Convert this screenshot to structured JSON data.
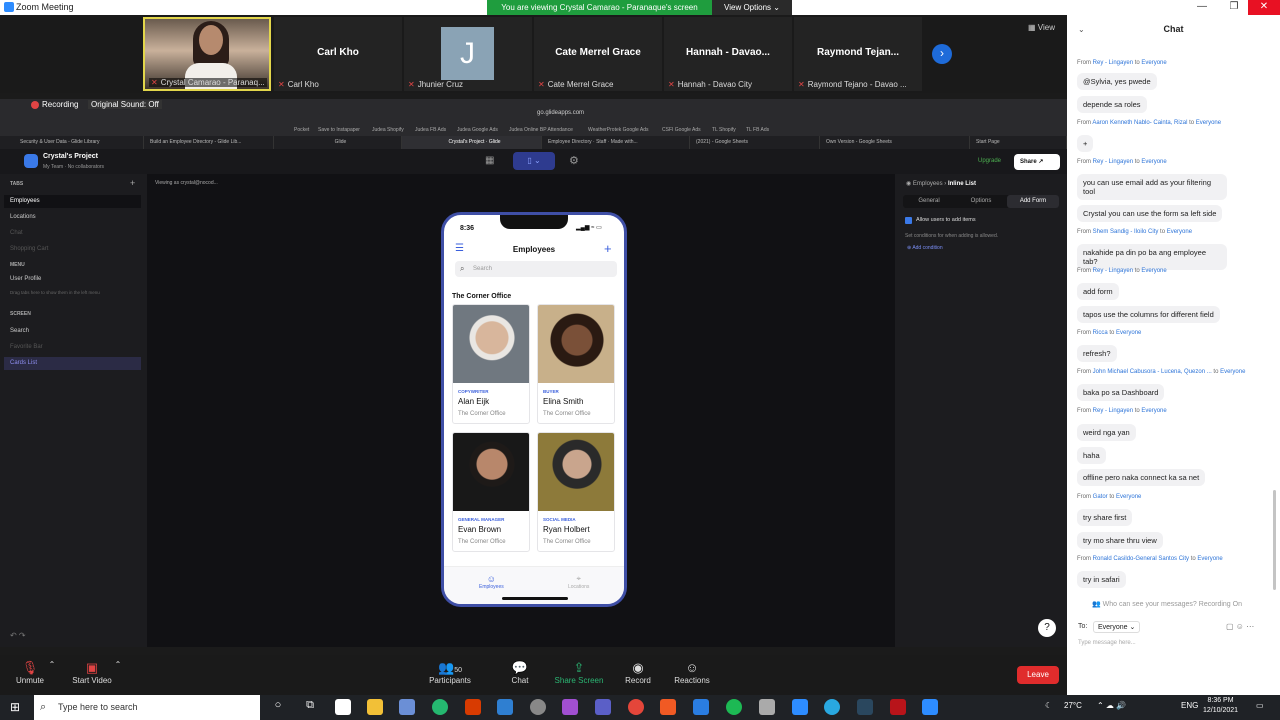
{
  "window": {
    "title": "Zoom Meeting",
    "banner": "You are viewing Crystal Camarao - Paranaque's screen",
    "view_options": "View Options ⌄",
    "minimize": "—",
    "restore": "❐",
    "close": "✕",
    "view_label": "View"
  },
  "participants": [
    {
      "name": "",
      "sub": "Crystal Camarao - Paranaq..."
    },
    {
      "name": "Carl Kho",
      "sub": "Carl Kho"
    },
    {
      "name": "",
      "avatar_letter": "J",
      "sub": "Jhunier Cruz"
    },
    {
      "name": "Cate Merrel Grace",
      "sub": "Cate Merrel Grace"
    },
    {
      "name": "Hannah - Davao...",
      "sub": "Hannah - Davao City"
    },
    {
      "name": "Raymond Tejan...",
      "sub": "Raymond Tejano - Davao ..."
    }
  ],
  "share": {
    "recording": "Recording",
    "original_sound": "Original Sound: Off",
    "url": "go.glideapps.com",
    "bookmarks": [
      "Pocket",
      "Save to Instapaper",
      "Judea Shopify",
      "Judea FB Ads",
      "Judea Google Ads",
      "Judea Online BP Attendance",
      "WeatherProtek Google Ads",
      "CSFI Google Ads",
      "TL Shopify",
      "TL FB Ads"
    ],
    "tabs": [
      {
        "label": "Security & User Data - Glide Library",
        "active": false
      },
      {
        "label": "Build an Employee Directory - Glide Lib...",
        "active": false
      },
      {
        "label": "Glide",
        "active": false
      },
      {
        "label": "Crystal's Project · Glide",
        "active": true
      },
      {
        "label": "Employee Directory · Staff · Made with...",
        "active": false
      },
      {
        "label": "(2021) - Google Sheets",
        "active": false
      },
      {
        "label": "Own Version - Google Sheets",
        "active": false
      },
      {
        "label": "Start Page",
        "active": false
      }
    ]
  },
  "glide": {
    "project_name": "Crystal's Project",
    "project_sub": "My Team · No collaborators",
    "upgrade": "Upgrade",
    "share": "Share",
    "viewing_as": "Viewing as crystal@nocod...",
    "sidebar": {
      "tabs_header": "TABS",
      "tabs": [
        "Employees",
        "Locations",
        "Chat",
        "Shopping Cart"
      ],
      "menu_header": "MENU",
      "menu": [
        "User Profile"
      ],
      "menu_hint": "Drag tabs here to show them in the left menu",
      "screen_header": "SCREEN",
      "screen": [
        "Search",
        "Favorite Bar",
        "Cards List"
      ]
    },
    "config": {
      "breadcrumb_parent": "Employees",
      "breadcrumb_current": "Inline List",
      "tabs": [
        "General",
        "Options",
        "Add Form"
      ],
      "allow_label": "Allow users to add items",
      "conditions_hint": "Set conditions for when adding is allowed.",
      "add_condition": "Add condition"
    }
  },
  "phone": {
    "time": "8:36",
    "status": "▂▄▆ ≈ ▭",
    "header": "Employees",
    "search_placeholder": "Search",
    "group": "The Corner Office",
    "cards": [
      {
        "role": "COPYWRITER",
        "name": "Alan Eijk",
        "office": "The Corner Office"
      },
      {
        "role": "BUYER",
        "name": "Elina Smith",
        "office": "The Corner Office"
      },
      {
        "role": "GENERAL MANAGER",
        "name": "Evan Brown",
        "office": "The Corner Office"
      },
      {
        "role": "SOCIAL MEDIA",
        "name": "Ryan Holbert",
        "office": "The Corner Office"
      }
    ],
    "tab_employees": "Employees",
    "tab_locations": "Locations"
  },
  "toolbar": {
    "unmute": "Unmute",
    "start_video": "Start Video",
    "participants": "Participants",
    "participants_count": "50",
    "chat": "Chat",
    "share_screen": "Share Screen",
    "record": "Record",
    "reactions": "Reactions",
    "leave": "Leave"
  },
  "chat": {
    "title": "Chat",
    "messages": [
      {
        "from": "Rey - Lingayen",
        "to": "Everyone",
        "text": "@Sylvia, yes pwede"
      },
      {
        "from": "",
        "to": "",
        "text": "depende sa roles"
      },
      {
        "from": "Aaron Kenneth Nablo- Cainta, Rizal",
        "to": "Everyone",
        "text": "+"
      },
      {
        "from": "Rey - Lingayen",
        "to": "Everyone",
        "text": "you can use email add as your filtering tool"
      },
      {
        "from": "",
        "to": "",
        "text": "Crystal you can use the form sa left side"
      },
      {
        "from": "Shem Sandig - Iloilo City",
        "to": "Everyone",
        "text": "nakahide pa din po ba ang employee tab?"
      },
      {
        "from": "Rey - Lingayen",
        "to": "Everyone",
        "text": "add form"
      },
      {
        "from": "",
        "to": "",
        "text": "tapos use the columns for different field"
      },
      {
        "from": "Ricca",
        "to": "Everyone",
        "text": "refresh?"
      },
      {
        "from": "John Michael Cabusora - Lucena, Quezon ...",
        "to": "Everyone",
        "text": "baka po sa Dashboard"
      },
      {
        "from": "Rey - Lingayen",
        "to": "Everyone",
        "text": "weird nga yan"
      },
      {
        "from": "",
        "to": "",
        "text": "haha"
      },
      {
        "from": "",
        "to": "",
        "text": "offline pero naka connect ka sa net"
      },
      {
        "from": "Gator",
        "to": "Everyone",
        "text": "try share first"
      },
      {
        "from": "",
        "to": "",
        "text": "try mo share thru view"
      },
      {
        "from": "Ronald Casildo-General Santos City",
        "to": "Everyone",
        "text": "try in safari"
      }
    ],
    "from_word": "From",
    "to_word": "to",
    "info": "Who can see your messages? Recording On",
    "to_label": "To:",
    "recipient": "Everyone ⌄",
    "input_placeholder": "Type message here..."
  },
  "taskbar": {
    "search_placeholder": "Type here to search",
    "temperature": "27°C",
    "language": "ENG",
    "time": "8:36 PM",
    "date": "12/10/2021"
  }
}
